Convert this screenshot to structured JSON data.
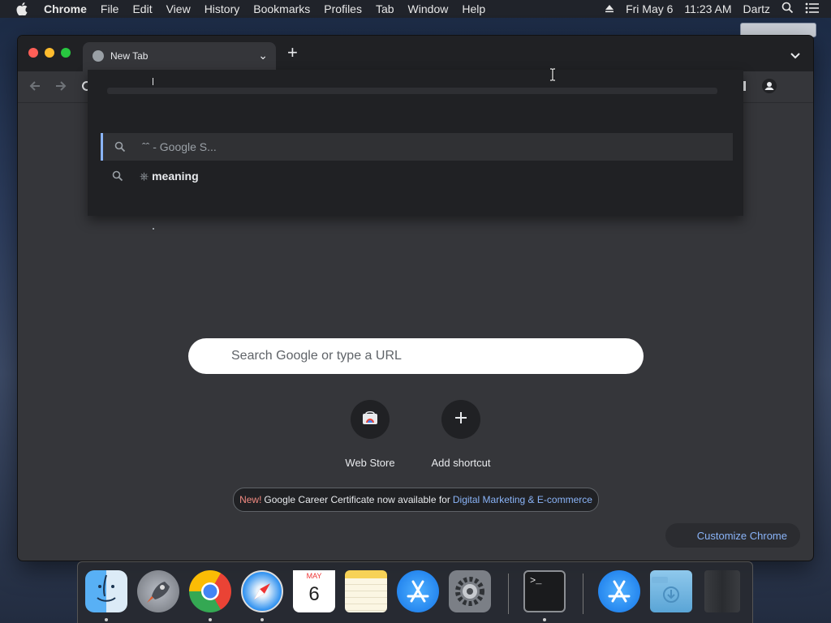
{
  "menubar": {
    "app": "Chrome",
    "items": [
      "File",
      "Edit",
      "View",
      "History",
      "Bookmarks",
      "Profiles",
      "Tab",
      "Window",
      "Help"
    ],
    "date": "Fri May 6",
    "time": "11:23 AM",
    "user": "Dartz"
  },
  "window": {
    "tab_title": "New Tab",
    "omnibox": {
      "suggestions": [
        {
          "text": "ˆˆ - Google S...",
          "icon": "search-icon"
        },
        {
          "prefix": "⎈ ",
          "bold": "meaning",
          "icon": "search-icon"
        }
      ]
    },
    "ntp": {
      "search_placeholder": "Search Google or type a URL",
      "shortcuts": [
        "Web Store",
        "Add shortcut"
      ],
      "promo": {
        "new_label": "New!",
        "text": "Google Career Certificate now available for",
        "link": "Digital Marketing & E-commerce"
      },
      "customize_label": "Customize Chrome"
    }
  },
  "dock": {
    "apps": [
      "Finder",
      "Launchpad",
      "Google Chrome",
      "Safari",
      "Calendar",
      "Notes",
      "App Store",
      "System Preferences",
      "Terminal",
      "App Store Downloads",
      "Downloads",
      "Trash"
    ],
    "calendar": {
      "month": "MAY",
      "day": "6"
    },
    "terminal_prompt": ">_"
  },
  "colors": {
    "accent": "#8ab4f8",
    "new_badge": "#f28b82",
    "window_bg": "#35363a",
    "titlebar_bg": "#202124"
  }
}
